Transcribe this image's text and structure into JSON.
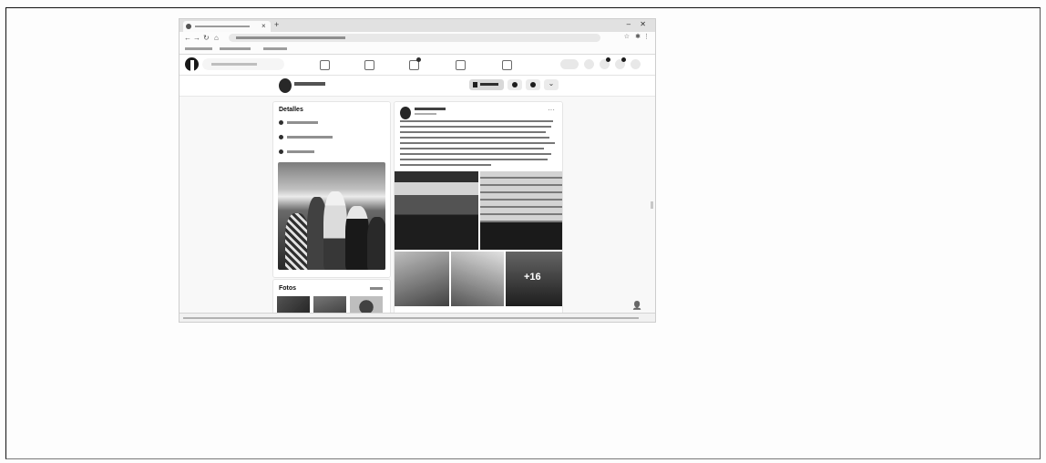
{
  "scan": {
    "note_visible": ""
  },
  "browser": {
    "tab_title": "",
    "url": "",
    "window_controls": "–   ✕",
    "new_tab": "+",
    "tab_close": "×",
    "nav_icons": [
      "back-icon",
      "forward-icon",
      "reload-icon",
      "home-icon"
    ]
  },
  "facebook": {
    "search_placeholder": "",
    "nav_tabs": [
      "home-icon",
      "friends-icon",
      "watch-icon",
      "marketplace-icon",
      "groups-icon"
    ],
    "profile": {
      "name": "",
      "message_button": "",
      "more_menu": "⌄"
    },
    "details_card": {
      "title": "Detalles",
      "rows": [
        {
          "icon": "work-icon",
          "text": ""
        },
        {
          "icon": "clock-icon",
          "text": ""
        },
        {
          "icon": "followers-icon",
          "text": ""
        }
      ]
    },
    "photos_card": {
      "title": "Fotos",
      "see_all": ""
    },
    "post": {
      "author": "",
      "time": "",
      "more": "···",
      "body": "",
      "photo_overlay_count": "+16"
    },
    "footer_right_icon": "person-add-icon"
  },
  "colors": {
    "page_bg": "#fdfdfd",
    "fb_bg": "#f0f2f5",
    "card_bg": "#ffffff",
    "frame": "#111111"
  }
}
